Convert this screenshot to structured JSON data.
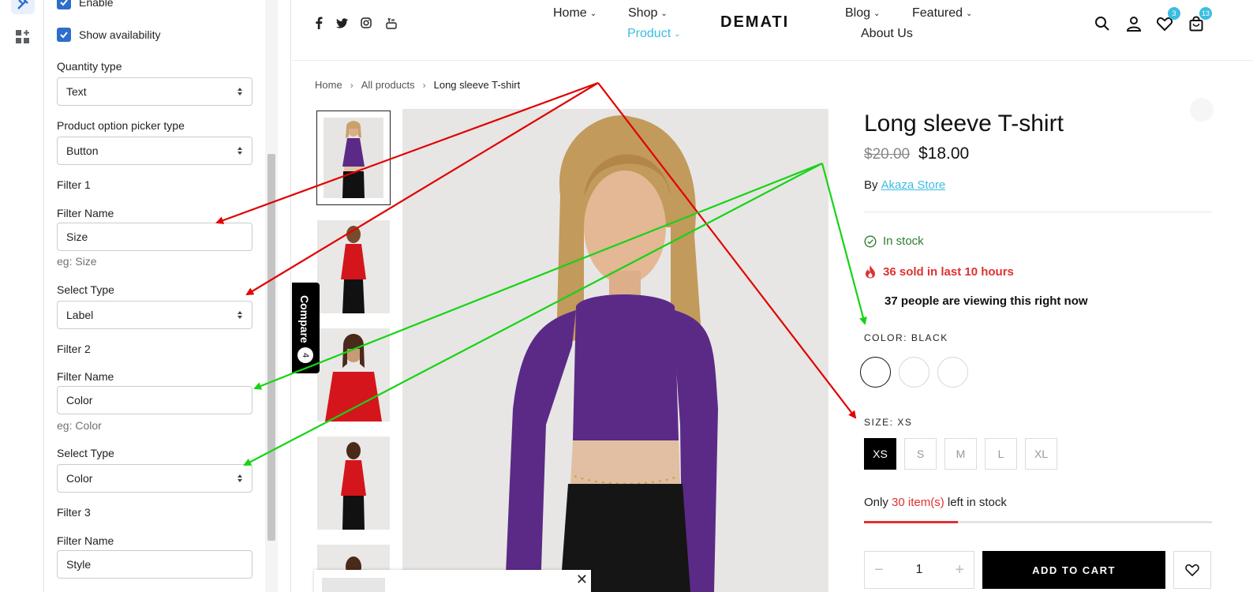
{
  "settings": {
    "enable_label": "Enable",
    "show_availability_label": "Show availability",
    "quantity_type": {
      "label": "Quantity type",
      "value": "Text"
    },
    "picker_type": {
      "label": "Product option picker type",
      "value": "Button"
    },
    "filter1": {
      "heading": "Filter 1",
      "name_label": "Filter Name",
      "name_value": "Size",
      "hint": "eg: Size",
      "type_label": "Select Type",
      "type_value": "Label"
    },
    "filter2": {
      "heading": "Filter 2",
      "name_label": "Filter Name",
      "name_value": "Color",
      "hint": "eg: Color",
      "type_label": "Select Type",
      "type_value": "Color"
    },
    "filter3": {
      "heading": "Filter 3",
      "name_label": "Filter Name",
      "name_value": "Style"
    }
  },
  "header": {
    "logo": "DEMATI",
    "nav": {
      "home": "Home",
      "shop": "Shop",
      "product": "Product",
      "blog": "Blog",
      "featured": "Featured",
      "about": "About Us"
    },
    "wishlist_count": "3",
    "cart_count": "13"
  },
  "breadcrumb": {
    "home": "Home",
    "all": "All products",
    "current": "Long sleeve T-shirt"
  },
  "compare": {
    "label": "Compare",
    "count": "4"
  },
  "product": {
    "title": "Long sleeve T-shirt",
    "price_old": "$20.00",
    "price_new": "$18.00",
    "vendor_prefix": "By",
    "vendor": "Akaza Store",
    "stock_status": "In stock",
    "sold_text": "36 sold in last 10 hours",
    "viewing_text": "37 people are viewing this right now",
    "color_label": "COLOR: BLACK",
    "size_label": "SIZE: XS",
    "sizes": [
      "XS",
      "S",
      "M",
      "L",
      "XL"
    ],
    "only_prefix": "Only",
    "only_count": "30 item(s)",
    "only_suffix": "left in stock",
    "stock_fraction": 0.27,
    "quantity": "1",
    "add_to_cart": "ADD TO CART"
  },
  "colors": {
    "accent": "#3bbde2",
    "sale_red": "#e03131",
    "stock_green": "#2e7d32",
    "arrow_red": "#e00000",
    "arrow_green": "#16d316",
    "top_purple": "#5b2a86",
    "top_red": "#d4161c"
  }
}
